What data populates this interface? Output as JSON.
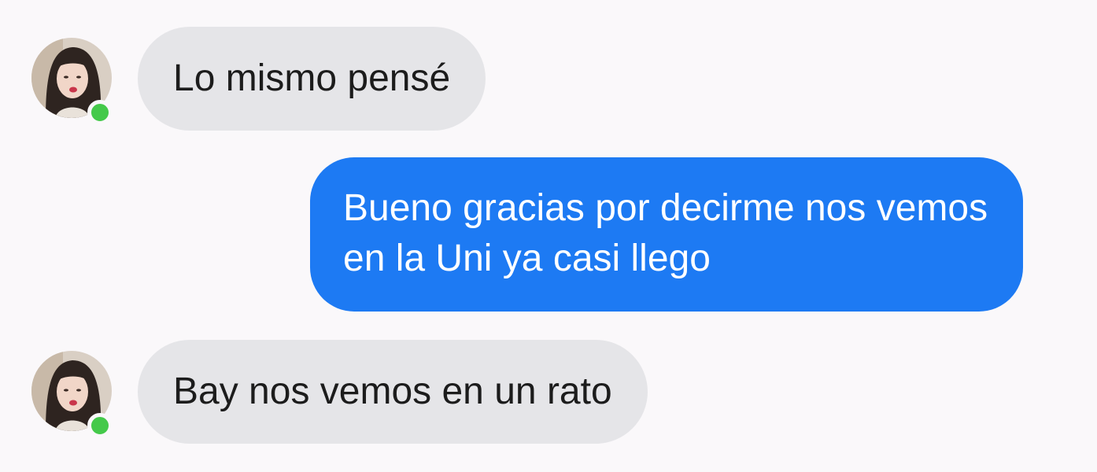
{
  "conversation": {
    "contact": {
      "avatar_icon": "contact-avatar-photo",
      "online_indicator_color": "#44c94a"
    },
    "colors": {
      "incoming_bubble": "#e5e5e8",
      "outgoing_bubble": "#1d7af3",
      "background": "#faf8fa"
    },
    "messages": [
      {
        "direction": "incoming",
        "text": "Lo mismo pensé"
      },
      {
        "direction": "outgoing",
        "text": "Bueno gracias por decirme nos vemos en la Uni ya casi llego"
      },
      {
        "direction": "incoming",
        "text": "Bay nos vemos en un rato"
      }
    ]
  }
}
